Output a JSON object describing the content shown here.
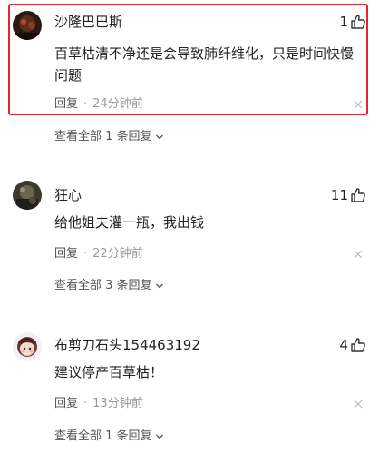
{
  "comments": [
    {
      "username": "沙隆巴巴斯",
      "likes": "1",
      "content": "百草枯清不净还是会导致肺纤维化，只是时间快慢问题",
      "reply_label": "回复",
      "separator": "·",
      "time": "24分钟前",
      "view_all": "查看全部 1 条回复",
      "highlighted": true
    },
    {
      "username": "狂心",
      "likes": "11",
      "content": "给他姐夫灌一瓶，我出钱",
      "reply_label": "回复",
      "separator": "·",
      "time": "22分钟前",
      "view_all": "查看全部 3 条回复",
      "highlighted": false
    },
    {
      "username": "布剪刀石头154463192",
      "likes": "4",
      "content": "建议停产百草枯！",
      "reply_label": "回复",
      "separator": "·",
      "time": "13分钟前",
      "view_all": "查看全部 1 条回复",
      "highlighted": false
    }
  ],
  "icons": {
    "like": "thumbs-up-icon",
    "close": "close-icon",
    "expand": "chevron-down-icon"
  },
  "colors": {
    "highlight_border": "#e6262b",
    "text_primary": "#222222",
    "text_secondary": "#999999"
  }
}
